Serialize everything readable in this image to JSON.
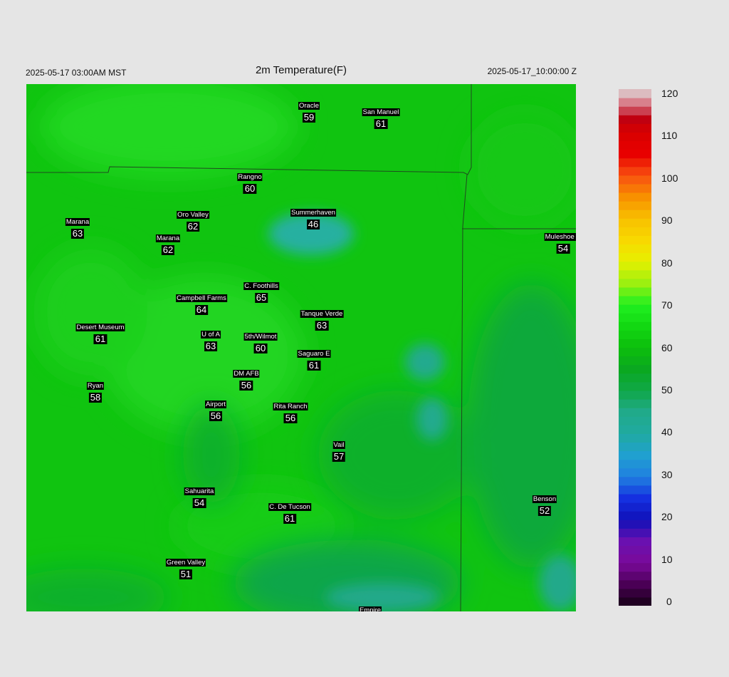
{
  "header": {
    "valid_local": "2025-05-17 03:00AM MST",
    "title": "2m Temperature(F)",
    "valid_z": "2025-05-17_10:00:00 Z"
  },
  "stations": [
    {
      "name": "Oracle",
      "value": "59"
    },
    {
      "name": "San Manuel",
      "value": "61"
    },
    {
      "name": "Rangno",
      "value": "60"
    },
    {
      "name": "Summerhaven",
      "value": "46"
    },
    {
      "name": "Marana",
      "value": "63"
    },
    {
      "name": "Oro Valley",
      "value": "62"
    },
    {
      "name": "Marana",
      "value": "62"
    },
    {
      "name": "Muleshoe R",
      "value": "54"
    },
    {
      "name": "C. Foothills",
      "value": "65"
    },
    {
      "name": "Campbell Farms",
      "value": "64"
    },
    {
      "name": "Tanque Verde",
      "value": "63"
    },
    {
      "name": "Desert Museum",
      "value": "61"
    },
    {
      "name": "U of A",
      "value": "63"
    },
    {
      "name": "5th/Wilmot",
      "value": "60"
    },
    {
      "name": "Saguaro E",
      "value": "61"
    },
    {
      "name": "DM AFB",
      "value": "56"
    },
    {
      "name": "Ryan",
      "value": "58"
    },
    {
      "name": "Airport",
      "value": "56"
    },
    {
      "name": "Rita Ranch",
      "value": "56"
    },
    {
      "name": "Vail",
      "value": "57"
    },
    {
      "name": "Sahuarita",
      "value": "54"
    },
    {
      "name": "C. De Tucson",
      "value": "61"
    },
    {
      "name": "Benson",
      "value": "52"
    },
    {
      "name": "Green Valley",
      "value": "51"
    },
    {
      "name": "Empire",
      "value": ""
    }
  ],
  "colorbar": {
    "ticks": [
      "120",
      "110",
      "100",
      "90",
      "80",
      "70",
      "60",
      "50",
      "40",
      "30",
      "20",
      "10",
      "0"
    ],
    "min": 0,
    "max": 120
  },
  "colors": {
    "field_warm": "#22d822",
    "field_mid": "#0ec20e",
    "field_cool": "#12a94c",
    "field_cold": "#21aa99",
    "boundary": "#1f4a1f"
  }
}
